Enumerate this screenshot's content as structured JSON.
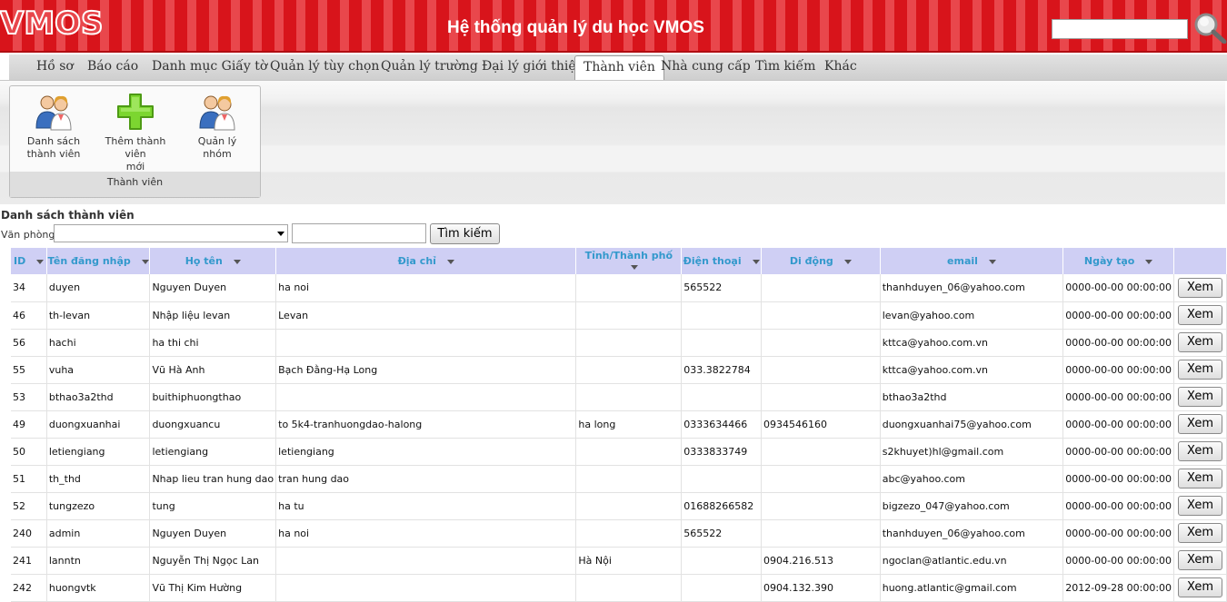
{
  "header": {
    "logo": "VMOS",
    "title": "Hệ thống quản lý du học VMOS",
    "search_value": ""
  },
  "nav": {
    "items": [
      "Hồ sơ",
      "Báo cáo",
      "Danh mục Giấy tờ",
      "Quản lý tùy chọn",
      "Quản lý trường",
      "Đại lý giới thiệu",
      "Thành viên",
      "Nhà cung cấp",
      "Tìm kiếm",
      "Khác"
    ],
    "active": "Thành viên"
  },
  "ribbon": {
    "group_label": "Thành viên",
    "buttons": [
      {
        "label_line1": "Danh sách",
        "label_line2": "thành viên",
        "icon": "users-icon"
      },
      {
        "label_line1": "Thêm thành viên",
        "label_line2": "mới",
        "icon": "add-plus-icon"
      },
      {
        "label_line1": "Quản lý nhóm",
        "label_line2": "",
        "icon": "group-icon"
      }
    ]
  },
  "page": {
    "section_title": "Danh sách thành viên",
    "office_label": "Văn phòng:",
    "office_selected": "",
    "search_value": "",
    "search_button": "Tìm kiếm"
  },
  "table": {
    "columns": [
      "ID",
      "Tên đăng nhập",
      "Họ tên",
      "Địa chỉ",
      "Tỉnh/Thành phố",
      "Điện thoại",
      "Di động",
      "email",
      "Ngày tạo",
      ""
    ],
    "action_label": "Xem",
    "rows": [
      [
        "34",
        "duyen",
        "Nguyen Duyen",
        "ha noi",
        "",
        "565522",
        "",
        "thanhduyen_06@yahoo.com",
        "0000-00-00 00:00:00"
      ],
      [
        "46",
        "th-levan",
        "Nhập liệu levan",
        "Levan",
        "",
        "",
        "",
        "levan@yahoo.com",
        "0000-00-00 00:00:00"
      ],
      [
        "56",
        "hachi",
        "ha thi chi",
        "",
        "",
        "",
        "",
        "kttca@yahoo.com.vn",
        "0000-00-00 00:00:00"
      ],
      [
        "55",
        "vuha",
        "Vũ Hà Anh",
        "Bạch Đằng-Hạ Long",
        "",
        "033.3822784",
        "",
        "kttca@yahoo.com.vn",
        "0000-00-00 00:00:00"
      ],
      [
        "53",
        "bthao3a2thd",
        "buithiphuongthao",
        "",
        "",
        "",
        "",
        "bthao3a2thd",
        "0000-00-00 00:00:00"
      ],
      [
        "49",
        "duongxuanhai",
        "duongxuancu",
        "to 5k4-tranhuongdao-halong",
        "ha long",
        "0333634466",
        "0934546160",
        "duongxuanhai75@yahoo.com",
        "0000-00-00 00:00:00"
      ],
      [
        "50",
        "letiengiang",
        "letiengiang",
        "letiengiang",
        "",
        "0333833749",
        "",
        "s2khuyet)hl@gmail.com",
        "0000-00-00 00:00:00"
      ],
      [
        "51",
        "th_thd",
        "Nhap lieu tran hung dao",
        "tran hung dao",
        "",
        "",
        "",
        "abc@yahoo.com",
        "0000-00-00 00:00:00"
      ],
      [
        "52",
        "tungzezo",
        "tung",
        "ha tu",
        "",
        "01688266582",
        "",
        "bigzezo_047@yahoo.com",
        "0000-00-00 00:00:00"
      ],
      [
        "240",
        "admin",
        "Nguyen Duyen",
        "ha noi",
        "",
        "565522",
        "",
        "thanhduyen_06@yahoo.com",
        "0000-00-00 00:00:00"
      ],
      [
        "241",
        "lanntn",
        "Nguyễn Thị Ngọc Lan",
        "",
        "Hà Nội",
        "",
        "0904.216.513",
        "ngoclan@atlantic.edu.vn",
        "0000-00-00 00:00:00"
      ],
      [
        "242",
        "huongvtk",
        "Vũ Thị Kim Hường",
        "",
        "",
        "",
        "0904.132.390",
        "huong.atlantic@gmail.com",
        "2012-09-28 00:00:00"
      ]
    ]
  },
  "colors": {
    "header_red": "#d8141b",
    "header_stripe": "#e9474c",
    "table_header_bg": "#cfcff4",
    "table_header_text": "#3399cc"
  }
}
